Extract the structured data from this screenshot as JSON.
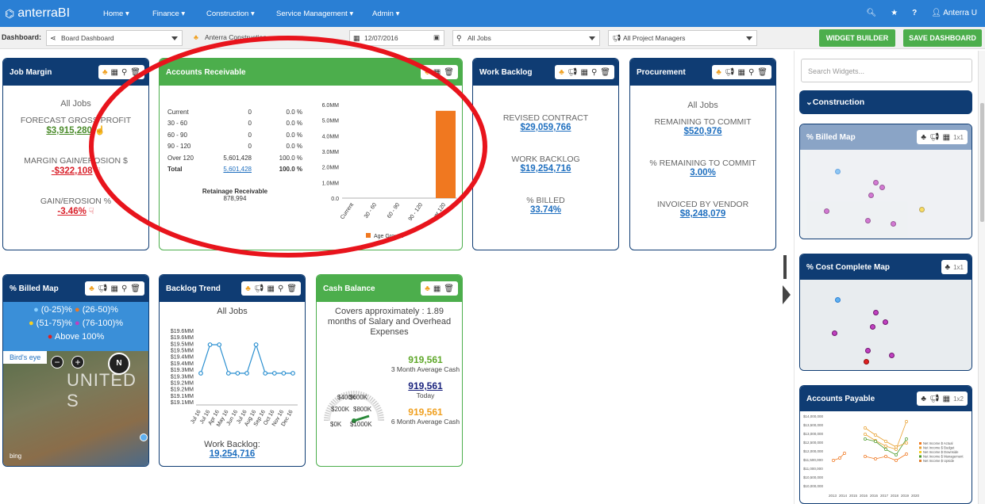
{
  "app": {
    "name": "anterraBI"
  },
  "nav": {
    "items": [
      "Home ▾",
      "Finance ▾",
      "Construction ▾",
      "Service Management ▾",
      "Admin ▾"
    ],
    "user": "Anterra U",
    "help": "?"
  },
  "toolbar": {
    "label": "Dashboard:",
    "dashboard": "Board Dashboard",
    "company": "Anterra Construction",
    "date": "12/07/2016",
    "jobs": "All Jobs",
    "managers": "All Project Managers",
    "widget_builder": "WIDGET BUILDER",
    "save_dashboard": "SAVE DASHBOARD"
  },
  "job_margin": {
    "title": "Job Margin",
    "subtitle": "All Jobs",
    "metrics": [
      {
        "label": "FORECAST GROSS PROFIT",
        "value": "$3,915,280"
      },
      {
        "label": "MARGIN GAIN/EROSION $",
        "value": "-$322,108"
      },
      {
        "label": "GAIN/EROSION %",
        "value": "-3.46%"
      }
    ]
  },
  "accounts_receivable": {
    "title": "Accounts Receivable",
    "rows": [
      {
        "label": "Current",
        "amount": "0",
        "pct": "0.0 %"
      },
      {
        "label": "30 - 60",
        "amount": "0",
        "pct": "0.0 %"
      },
      {
        "label": "60 - 90",
        "amount": "0",
        "pct": "0.0 %"
      },
      {
        "label": "90 - 120",
        "amount": "0",
        "pct": "0.0 %"
      },
      {
        "label": "Over 120",
        "amount": "5,601,428",
        "pct": "100.0 %"
      },
      {
        "label": "Total",
        "amount": "5,601,428",
        "pct": "100.0 %"
      }
    ],
    "retainage_label": "Retainage Receivable",
    "retainage_value": "878,994"
  },
  "work_backlog": {
    "title": "Work Backlog",
    "metrics": [
      {
        "label": "REVISED CONTRACT",
        "value": "$29,059,766"
      },
      {
        "label": "WORK BACKLOG",
        "value": "$19,254,716"
      },
      {
        "label": "% BILLED",
        "value": "33.74%"
      }
    ]
  },
  "procurement": {
    "title": "Procurement",
    "subtitle": "All Jobs",
    "metrics": [
      {
        "label": "REMAINING TO COMMIT",
        "value": "$520,976"
      },
      {
        "label": "% REMAINING TO COMMIT",
        "value": "3.00%"
      },
      {
        "label": "INVOICED BY VENDOR",
        "value": "$8,248,079"
      }
    ]
  },
  "billed_map": {
    "title": "% Billed Map",
    "legend": [
      "(0-25)%",
      "(26-50)%",
      "(51-75)%",
      "(76-100)%",
      "Above 100%"
    ],
    "birds_eye": "Bird's eye",
    "map_label": "UNITED S",
    "bing": "bing"
  },
  "backlog_trend": {
    "title": "Backlog Trend",
    "subtitle": "All Jobs",
    "footer_label": "Work Backlog:",
    "footer_value": "19,254,716"
  },
  "cash_balance": {
    "title": "Cash Balance",
    "covers": "Covers approximately : 1.89 months of Salary and Overhead Expenses",
    "gauge_labels": [
      "$400K",
      "$600K",
      "$200K",
      "$800K",
      "$0K",
      "$1000K"
    ],
    "stats": [
      {
        "value": "919,561",
        "label": "3 Month Average Cash",
        "color": "#5fa82a"
      },
      {
        "value": "919,561",
        "label": "Today",
        "color": "#1a237e"
      },
      {
        "value": "919,561",
        "label": "6 Month Average Cash",
        "color": "#f0a020"
      }
    ]
  },
  "sidebar": {
    "search_placeholder": "Search Widgets...",
    "section": "Construction",
    "widgets": [
      {
        "title": "% Billed Map",
        "size": "1x1"
      },
      {
        "title": "% Cost Complete Map",
        "size": "1x1"
      },
      {
        "title": "Accounts Payable",
        "size": "1x2"
      }
    ],
    "ap_legend": [
      "Net Income $ Actual",
      "Net Income $ Budget",
      "Net Income $ Downside",
      "Net Income $ Management",
      "Net Income $ Upside"
    ],
    "ap_yticks": [
      "$14,000,000",
      "$13,500,000",
      "$13,000,000",
      "$12,500,000",
      "$12,000,000",
      "$11,500,000",
      "$11,000,000",
      "$10,500,000",
      "$10,000,000"
    ],
    "ap_xticks": [
      "2013",
      "2014",
      "2015",
      "2016",
      "2016",
      "2017",
      "2018",
      "2019",
      "2020"
    ]
  },
  "chart_data": [
    {
      "type": "bar",
      "categories": [
        "Current",
        "30 - 60",
        "60 - 90",
        "90 - 120",
        "Over 120"
      ],
      "values": [
        0,
        0,
        0,
        0,
        5601428
      ],
      "series": [
        {
          "name": "Age Groups",
          "values": [
            0,
            0,
            0,
            0,
            5601428
          ]
        }
      ],
      "yticks": [
        "0.0",
        "1.0MM",
        "2.0MM",
        "3.0MM",
        "4.0MM",
        "5.0MM",
        "6.0MM"
      ],
      "ylim": [
        0,
        6000000
      ],
      "legend": "Age Groups",
      "color": "#f07820"
    },
    {
      "type": "line",
      "categories": [
        "Jul 16",
        "Jul 16",
        "Apr 16",
        "May 16",
        "Jun 16",
        "Jul 16",
        "Aug 16",
        "Sep 16",
        "Oct 16",
        "Nov 16",
        "Dec 16"
      ],
      "values": [
        19.3,
        19.5,
        19.5,
        19.3,
        19.3,
        19.3,
        19.5,
        19.3,
        19.3,
        19.3,
        19.3
      ],
      "yticks": [
        "$19.6MM",
        "$19.6MM",
        "$19.5MM",
        "$19.5MM",
        "$19.4MM",
        "$19.4MM",
        "$19.3MM",
        "$19.3MM",
        "$19.2MM",
        "$19.2MM",
        "$19.1MM",
        "$19.1MM"
      ],
      "ylim": [
        19.1,
        19.6
      ],
      "color": "#2a8fd0"
    }
  ]
}
